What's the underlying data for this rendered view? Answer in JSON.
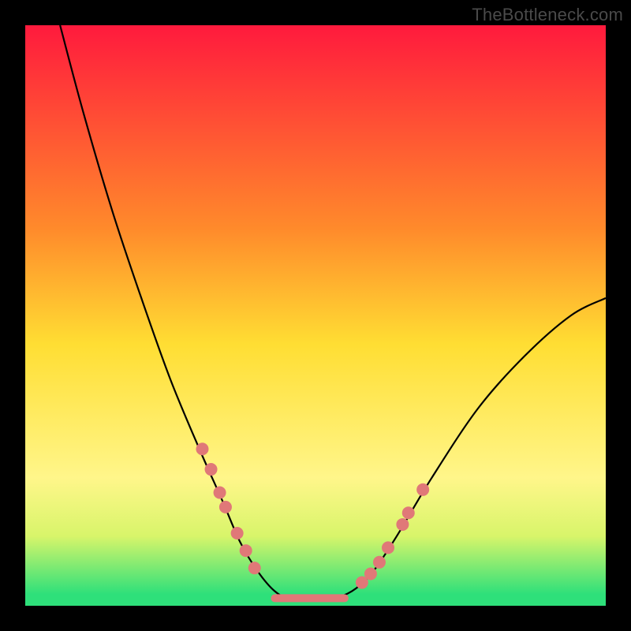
{
  "watermark": "TheBottleneck.com",
  "chart_data": {
    "type": "line",
    "title": "",
    "xlabel": "",
    "ylabel": "",
    "xlim": [
      0,
      100
    ],
    "ylim": [
      0,
      100
    ],
    "grid": false,
    "legend": false,
    "background_gradient": {
      "stops": [
        {
          "offset": 0.0,
          "color": "#ff1a3d"
        },
        {
          "offset": 0.35,
          "color": "#ff8a2b"
        },
        {
          "offset": 0.55,
          "color": "#ffde33"
        },
        {
          "offset": 0.78,
          "color": "#fff68a"
        },
        {
          "offset": 0.88,
          "color": "#d8f56a"
        },
        {
          "offset": 0.98,
          "color": "#2ee07a"
        }
      ]
    },
    "curve_points": [
      {
        "x": 6,
        "y": 100
      },
      {
        "x": 10,
        "y": 85
      },
      {
        "x": 15,
        "y": 68
      },
      {
        "x": 20,
        "y": 53
      },
      {
        "x": 25,
        "y": 39
      },
      {
        "x": 30,
        "y": 27
      },
      {
        "x": 34,
        "y": 18
      },
      {
        "x": 37,
        "y": 11
      },
      {
        "x": 40,
        "y": 6
      },
      {
        "x": 43,
        "y": 2.5
      },
      {
        "x": 46,
        "y": 1
      },
      {
        "x": 50,
        "y": 1
      },
      {
        "x": 54,
        "y": 1.5
      },
      {
        "x": 57,
        "y": 3
      },
      {
        "x": 60,
        "y": 6
      },
      {
        "x": 64,
        "y": 12
      },
      {
        "x": 70,
        "y": 22
      },
      {
        "x": 78,
        "y": 34
      },
      {
        "x": 86,
        "y": 43
      },
      {
        "x": 94,
        "y": 50
      },
      {
        "x": 100,
        "y": 53
      }
    ],
    "dot_points_left": [
      {
        "x": 30.5,
        "y": 27
      },
      {
        "x": 32,
        "y": 23.5
      },
      {
        "x": 33.5,
        "y": 19.5
      },
      {
        "x": 34.5,
        "y": 17
      },
      {
        "x": 36.5,
        "y": 12.5
      },
      {
        "x": 38,
        "y": 9.5
      },
      {
        "x": 39.5,
        "y": 6.5
      }
    ],
    "dot_points_right": [
      {
        "x": 58,
        "y": 4
      },
      {
        "x": 59.5,
        "y": 5.5
      },
      {
        "x": 61,
        "y": 7.5
      },
      {
        "x": 62.5,
        "y": 10
      },
      {
        "x": 65,
        "y": 14
      },
      {
        "x": 66,
        "y": 16
      },
      {
        "x": 68.5,
        "y": 20
      }
    ],
    "flat_segment": {
      "x1": 43,
      "x2": 55,
      "y": 1.3
    },
    "colors": {
      "curve_stroke": "#000000",
      "dot_fill": "#e07878",
      "flat_stroke": "#e07878"
    }
  }
}
